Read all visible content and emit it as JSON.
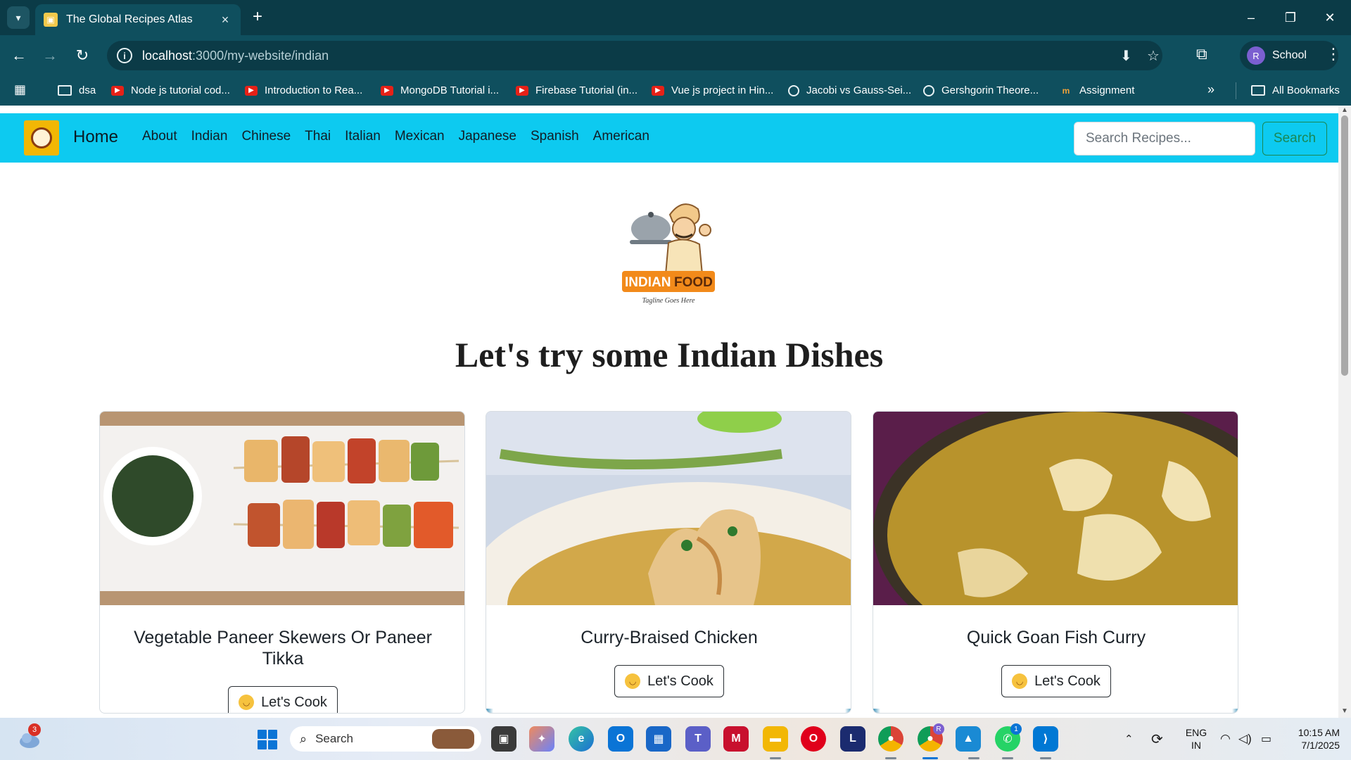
{
  "browser": {
    "tab_title": "The Global Recipes Atlas",
    "url_host": "localhost",
    "url_path": ":3000/my-website/indian",
    "profile_label": "School",
    "profile_initial": "R",
    "bookmarks": [
      {
        "label": "dsa",
        "icon": "folder-icon"
      },
      {
        "label": "Node js tutorial cod...",
        "icon": "youtube-icon"
      },
      {
        "label": "Introduction to Rea...",
        "icon": "youtube-icon"
      },
      {
        "label": "MongoDB Tutorial i...",
        "icon": "youtube-icon"
      },
      {
        "label": "Firebase Tutorial (in...",
        "icon": "youtube-icon"
      },
      {
        "label": "Vue js project in Hin...",
        "icon": "youtube-icon"
      },
      {
        "label": "Jacobi vs Gauss-Sei...",
        "icon": "openai-icon"
      },
      {
        "label": "Gershgorin Theore...",
        "icon": "openai-icon"
      },
      {
        "label": "Assignment",
        "icon": "coursera-icon"
      }
    ],
    "all_bookmarks_label": "All Bookmarks"
  },
  "site": {
    "brand": "Home",
    "nav_links": [
      "About",
      "Indian",
      "Chinese",
      "Thai",
      "Italian",
      "Mexican",
      "Japanese",
      "Spanish",
      "American"
    ],
    "search_placeholder": "Search Recipes...",
    "search_button": "Search",
    "accent_color": "#0dcaf0"
  },
  "hero": {
    "logo_text_primary": "INDIAN",
    "logo_text_secondary": "FOOD",
    "logo_tagline": "Tagline Goes Here",
    "heading": "Let's try some Indian Dishes"
  },
  "cards": [
    {
      "title": "Vegetable Paneer Skewers Or Paneer Tikka",
      "button": "Let's Cook"
    },
    {
      "title": "Curry-Braised Chicken",
      "button": "Let's Cook"
    },
    {
      "title": "Quick Goan Fish Curry",
      "button": "Let's Cook"
    }
  ],
  "taskbar": {
    "search_label": "Search",
    "weather_badge": "3",
    "chrome_badge": "R",
    "whatsapp_badge": "1",
    "lang_line1": "ENG",
    "lang_line2": "IN",
    "time": "10:15 AM",
    "date": "7/1/2025"
  }
}
